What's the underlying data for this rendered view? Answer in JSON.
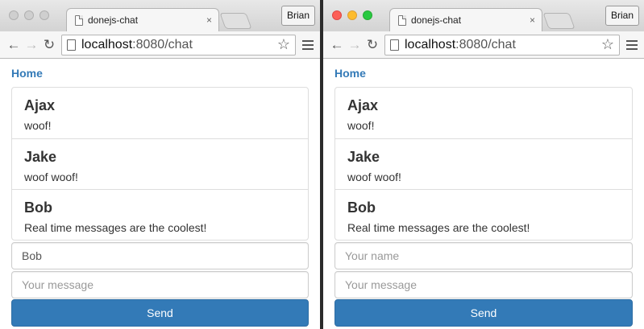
{
  "windows": [
    {
      "state": "inactive",
      "tab_title": "donejs-chat",
      "tab_close": "×",
      "profile": "Brian",
      "url_host": "localhost",
      "url_path": ":8080/chat",
      "nav_back": "←",
      "nav_forward": "→",
      "nav_reload": "↻",
      "star": "☆",
      "home_link": "Home",
      "messages": [
        {
          "name": "Ajax",
          "body": "woof!"
        },
        {
          "name": "Jake",
          "body": "woof woof!"
        },
        {
          "name": "Bob",
          "body": "Real time messages are the coolest!"
        }
      ],
      "name_value": "Bob",
      "name_placeholder": "Your name",
      "message_value": "",
      "message_placeholder": "Your message",
      "send_label": "Send"
    },
    {
      "state": "active",
      "tab_title": "donejs-chat",
      "tab_close": "×",
      "profile": "Brian",
      "url_host": "localhost",
      "url_path": ":8080/chat",
      "nav_back": "←",
      "nav_forward": "→",
      "nav_reload": "↻",
      "star": "☆",
      "home_link": "Home",
      "messages": [
        {
          "name": "Ajax",
          "body": "woof!"
        },
        {
          "name": "Jake",
          "body": "woof woof!"
        },
        {
          "name": "Bob",
          "body": "Real time messages are the coolest!"
        }
      ],
      "name_value": "",
      "name_placeholder": "Your name",
      "message_value": "",
      "message_placeholder": "Your message",
      "send_label": "Send"
    }
  ],
  "colors": {
    "link": "#337ab7",
    "send_button": "#337ab7",
    "traffic_red": "#fc5f57",
    "traffic_yellow": "#fdbc2e",
    "traffic_green": "#28c940"
  }
}
